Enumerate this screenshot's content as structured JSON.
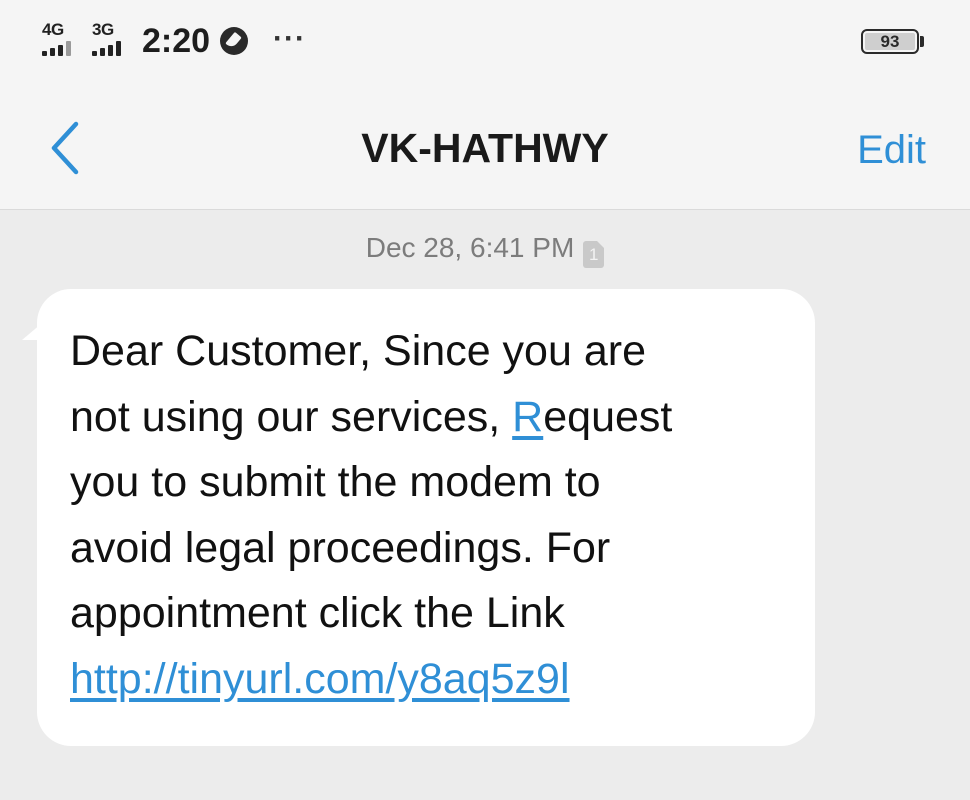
{
  "status_bar": {
    "network_1": "4G",
    "network_2": "3G",
    "time": "2:20",
    "sync_icon": "compass-icon",
    "more_icon": "more-dots-icon",
    "more_text": "···",
    "battery_level": "93"
  },
  "header": {
    "back_icon": "chevron-left-icon",
    "title": "VK-HATHWY",
    "edit_label": "Edit"
  },
  "conversation": {
    "timestamp": "Dec 28, 6:41 PM",
    "sim_slot": "1",
    "message": {
      "text_before": "Dear Customer, Since you are\nnot using our services, ",
      "linked_letter": "R",
      "text_after": "equest\nyou to submit the modem to\navoid legal proceedings. For\nappointment click the Link\n",
      "link": "http://tinyurl.com/y8aq5z9l"
    }
  },
  "colors": {
    "accent": "#2f8fd6",
    "background": "#ececec",
    "bar_background": "#f5f5f5",
    "bubble": "#ffffff",
    "text": "#111111",
    "muted_text": "#7c7c7c"
  }
}
